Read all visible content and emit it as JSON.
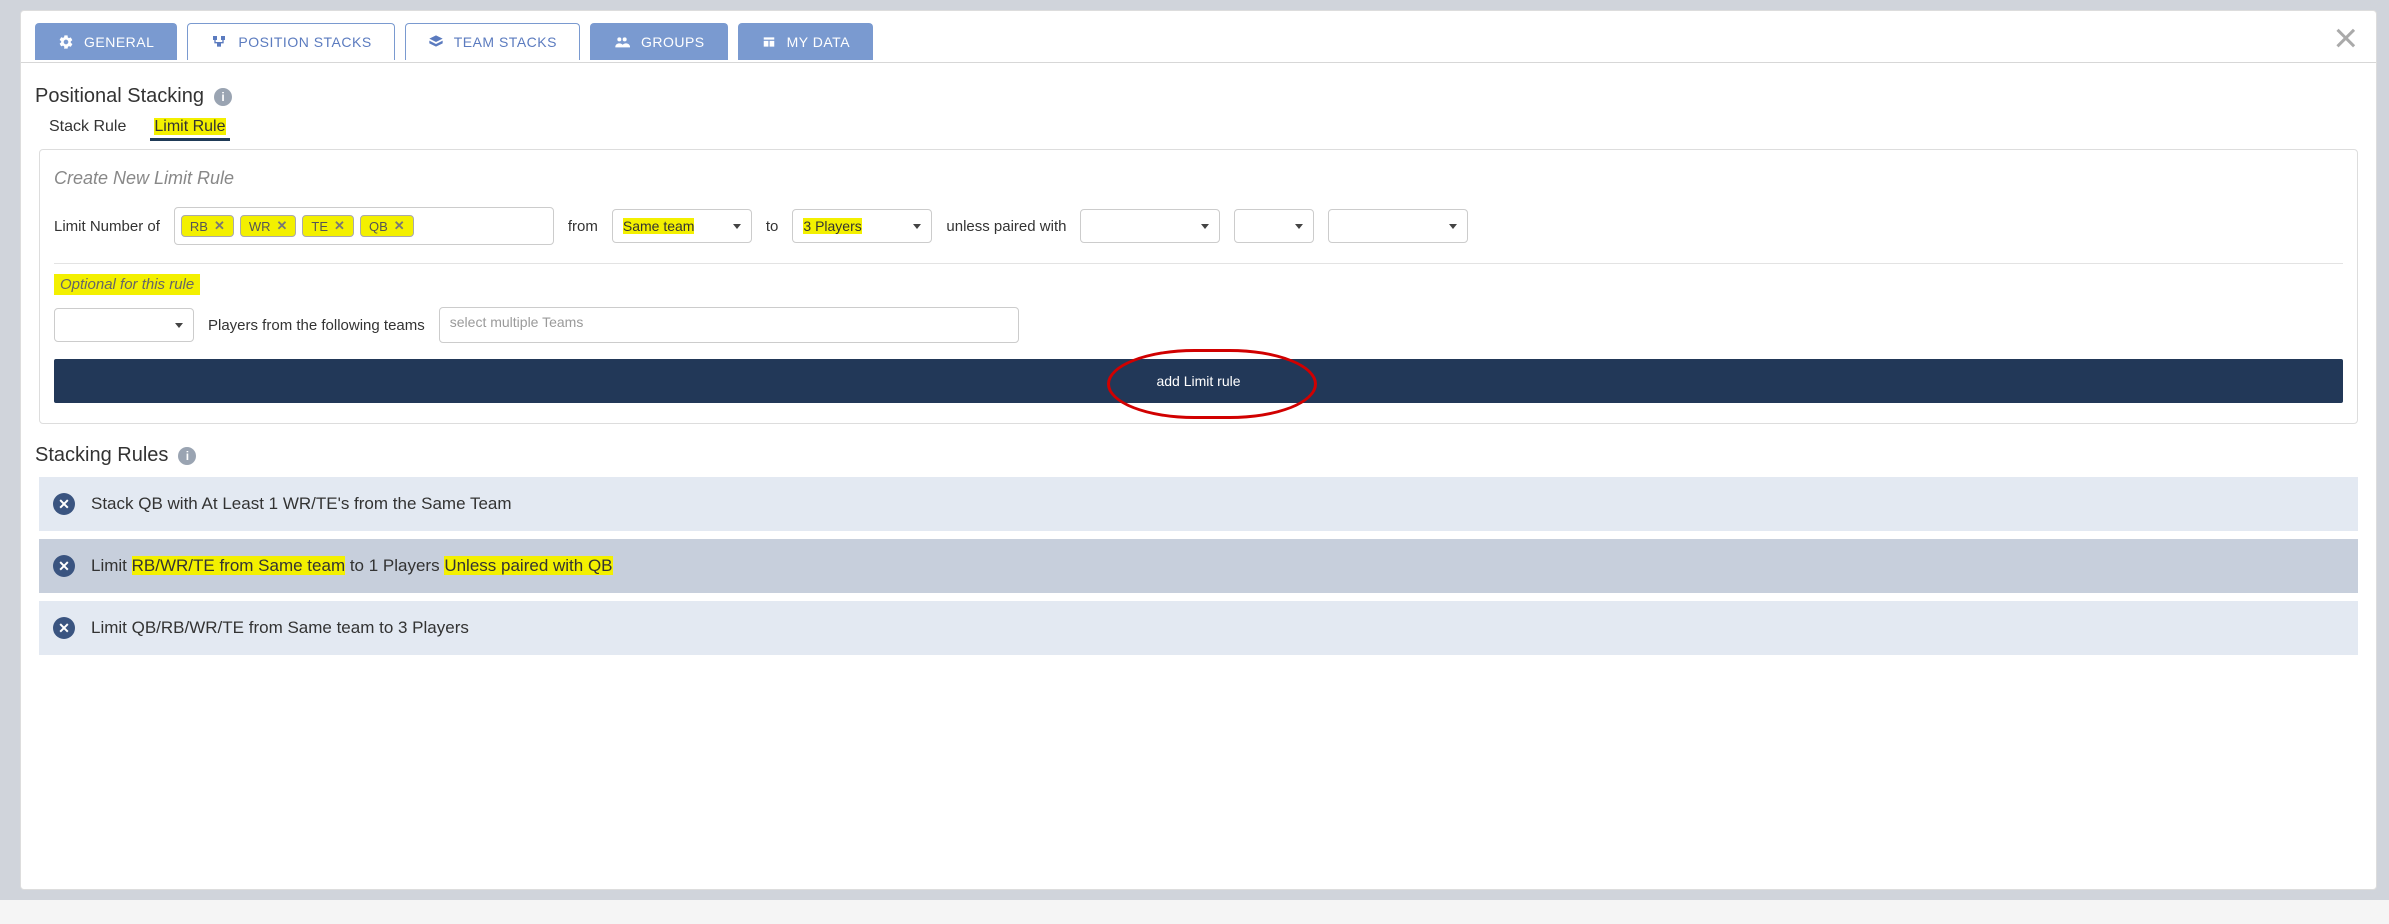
{
  "tabs": {
    "general": "GENERAL",
    "position_stacks": "POSITION STACKS",
    "team_stacks": "TEAM STACKS",
    "groups": "GROUPS",
    "my_data": "MY DATA"
  },
  "section": {
    "title": "Positional Stacking",
    "subtab_stack": "Stack Rule",
    "subtab_limit": "Limit Rule"
  },
  "panel": {
    "title": "Create New Limit Rule",
    "limit_label": "Limit Number of",
    "tags": {
      "rb": "RB",
      "wr": "WR",
      "te": "TE",
      "qb": "QB"
    },
    "from_label": "from",
    "from_value": "Same team",
    "to_label": "to",
    "to_value": "3 Players",
    "unless_label": "unless paired with",
    "optional_label": "Optional for this rule",
    "players_from_label": "Players from the following teams",
    "teams_placeholder": "select multiple Teams",
    "add_button": "add Limit rule"
  },
  "rules": {
    "header": "Stacking Rules",
    "items": [
      {
        "pre": "Stack QB with At Least 1 WR/TE's from the Same Team"
      },
      {
        "pre": "Limit ",
        "hl1": "RB/WR/TE from Same team",
        "mid": " to 1 Players ",
        "hl2": "Unless paired with QB"
      },
      {
        "pre": "Limit QB/RB/WR/TE from Same team to 3 Players"
      }
    ]
  }
}
